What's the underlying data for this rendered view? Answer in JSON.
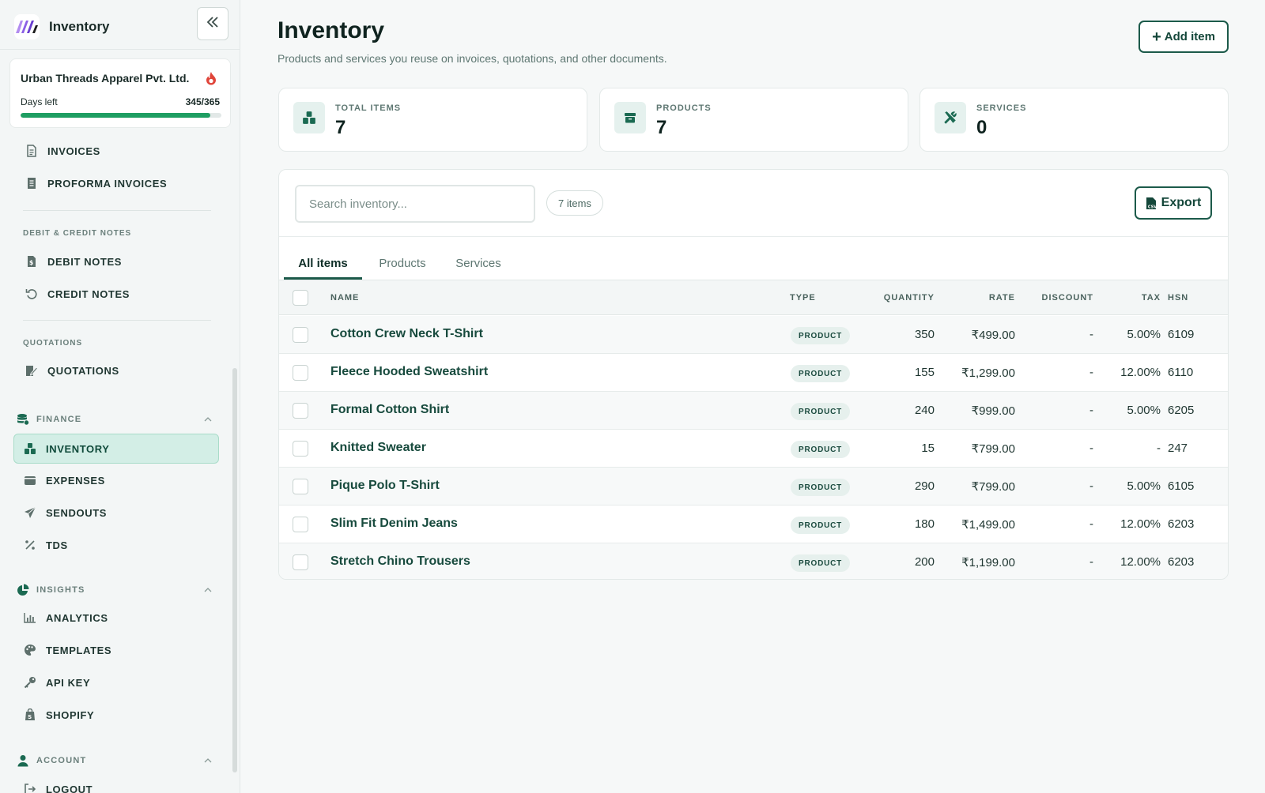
{
  "sidebar": {
    "brand_title": "Inventory",
    "org": {
      "name": "Urban Threads Apparel Pvt. Ltd.",
      "days_label": "Days left",
      "days_count": "345/365",
      "days_fraction": 0.945
    },
    "items_top": [
      {
        "label": "INVOICES"
      },
      {
        "label": "PROFORMA INVOICES"
      }
    ],
    "debit_credit_label": "DEBIT & CREDIT NOTES",
    "debit_credit_items": [
      {
        "label": "DEBIT NOTES"
      },
      {
        "label": "CREDIT NOTES"
      }
    ],
    "quotations_label": "QUOTATIONS",
    "quotations_items": [
      {
        "label": "QUOTATIONS"
      }
    ],
    "finance": {
      "label": "FINANCE",
      "items": [
        {
          "label": "INVENTORY"
        },
        {
          "label": "EXPENSES"
        },
        {
          "label": "SENDOUTS"
        },
        {
          "label": "TDS"
        }
      ]
    },
    "insights": {
      "label": "INSIGHTS",
      "items": [
        {
          "label": "ANALYTICS"
        },
        {
          "label": "TEMPLATES"
        },
        {
          "label": "API KEY"
        },
        {
          "label": "SHOPIFY"
        }
      ]
    },
    "account": {
      "label": "ACCOUNT",
      "items": [
        {
          "label": "LOGOUT"
        }
      ]
    }
  },
  "header": {
    "title": "Inventory",
    "subtitle": "Products and services you reuse on invoices, quotations, and other documents.",
    "add_label": "Add item"
  },
  "stats": [
    {
      "label": "TOTAL ITEMS",
      "value": "7",
      "icon": "boxes-icon"
    },
    {
      "label": "PRODUCTS",
      "value": "7",
      "icon": "box-icon"
    },
    {
      "label": "SERVICES",
      "value": "0",
      "icon": "tools-icon"
    }
  ],
  "toolbar": {
    "search_placeholder": "Search inventory...",
    "count_label": "7 items",
    "export_label": "Export"
  },
  "tabs": [
    {
      "label": "All items"
    },
    {
      "label": "Products"
    },
    {
      "label": "Services"
    }
  ],
  "table": {
    "columns": [
      "NAME",
      "TYPE",
      "QUANTITY",
      "RATE",
      "DISCOUNT",
      "TAX",
      "HSN"
    ],
    "rows": [
      {
        "name": "Cotton Crew Neck T-Shirt",
        "type": "PRODUCT",
        "quantity": "350",
        "rate": "₹499.00",
        "discount": "-",
        "tax": "5.00%",
        "hsn": "6109"
      },
      {
        "name": "Fleece Hooded Sweatshirt",
        "type": "PRODUCT",
        "quantity": "155",
        "rate": "₹1,299.00",
        "discount": "-",
        "tax": "12.00%",
        "hsn": "6110"
      },
      {
        "name": "Formal Cotton Shirt",
        "type": "PRODUCT",
        "quantity": "240",
        "rate": "₹999.00",
        "discount": "-",
        "tax": "5.00%",
        "hsn": "6205"
      },
      {
        "name": "Knitted Sweater",
        "type": "PRODUCT",
        "quantity": "15",
        "rate": "₹799.00",
        "discount": "-",
        "tax": "-",
        "hsn": "247"
      },
      {
        "name": "Pique Polo T-Shirt",
        "type": "PRODUCT",
        "quantity": "290",
        "rate": "₹799.00",
        "discount": "-",
        "tax": "5.00%",
        "hsn": "6105"
      },
      {
        "name": "Slim Fit Denim Jeans",
        "type": "PRODUCT",
        "quantity": "180",
        "rate": "₹1,499.00",
        "discount": "-",
        "tax": "12.00%",
        "hsn": "6203"
      },
      {
        "name": "Stretch Chino Trousers",
        "type": "PRODUCT",
        "quantity": "200",
        "rate": "₹1,199.00",
        "discount": "-",
        "tax": "12.00%",
        "hsn": "6203"
      }
    ]
  },
  "colors": {
    "accent": "#1c5a4a",
    "progress": "#1e9e62",
    "active_nav": "#d3eee6",
    "fire": "#e0453a",
    "logo": "#7b4fd6"
  }
}
